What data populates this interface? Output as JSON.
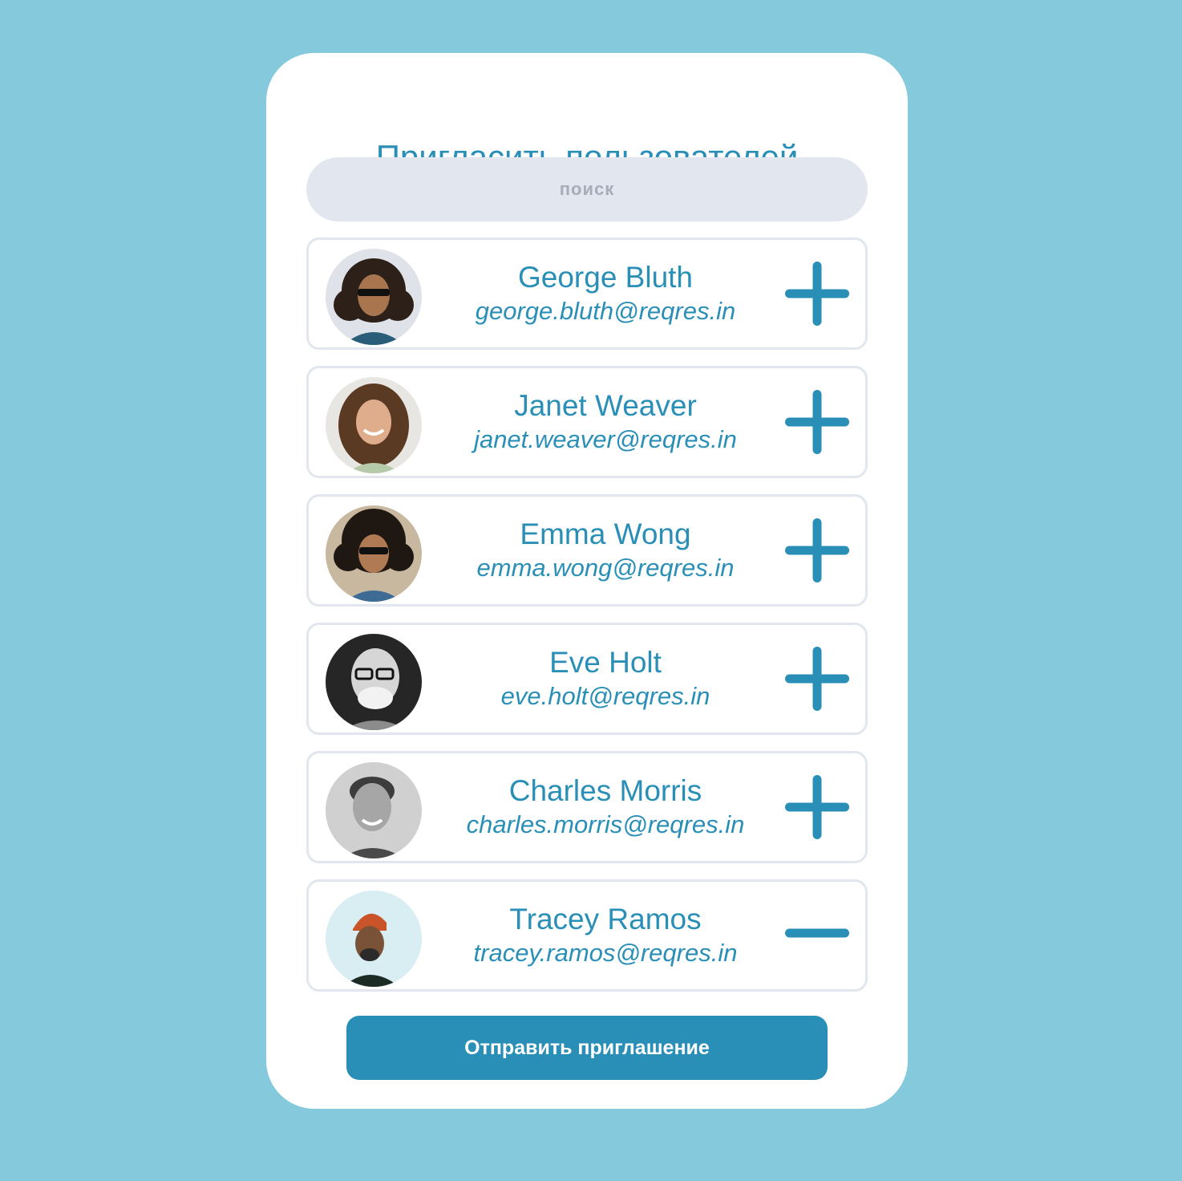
{
  "dialog": {
    "title": "Пригласить пользователей",
    "search_placeholder": "поиск",
    "submit_label": "Отправить приглашение"
  },
  "users": [
    {
      "name": "George Bluth",
      "email": "george.bluth@reqres.in",
      "action": "add"
    },
    {
      "name": "Janet Weaver",
      "email": "janet.weaver@reqres.in",
      "action": "add"
    },
    {
      "name": "Emma Wong",
      "email": "emma.wong@reqres.in",
      "action": "add"
    },
    {
      "name": "Eve Holt",
      "email": "eve.holt@reqres.in",
      "action": "add"
    },
    {
      "name": "Charles Morris",
      "email": "charles.morris@reqres.in",
      "action": "add"
    },
    {
      "name": "Tracey Ramos",
      "email": "tracey.ramos@reqres.in",
      "action": "remove"
    }
  ],
  "icons": {
    "add": "plus-icon",
    "remove": "minus-icon"
  },
  "colors": {
    "background": "#84cadc",
    "accent": "#2a8fb7",
    "field": "#e1e6ef"
  }
}
